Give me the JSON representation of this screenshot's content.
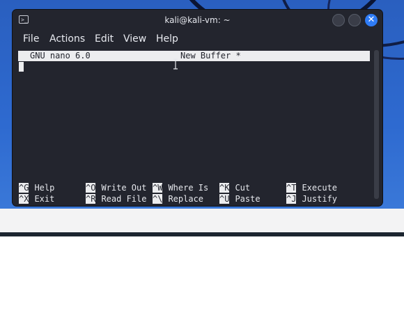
{
  "window": {
    "title": "kali@kali-vm: ~",
    "menu": [
      "File",
      "Actions",
      "Edit",
      "View",
      "Help"
    ]
  },
  "nano": {
    "version": "GNU nano 6.0",
    "buffer": "New Buffer *",
    "shortcuts_row1": [
      {
        "key": "^G",
        "label": "Help"
      },
      {
        "key": "^O",
        "label": "Write Out"
      },
      {
        "key": "^W",
        "label": "Where Is"
      },
      {
        "key": "^K",
        "label": "Cut"
      },
      {
        "key": "^T",
        "label": "Execute"
      }
    ],
    "shortcuts_row2": [
      {
        "key": "^X",
        "label": "Exit"
      },
      {
        "key": "^R",
        "label": "Read File"
      },
      {
        "key": "^\\",
        "label": "Replace"
      },
      {
        "key": "^U",
        "label": "Paste"
      },
      {
        "key": "^J",
        "label": "Justify"
      }
    ]
  },
  "colors": {
    "terminal_bg": "#23252e",
    "nano_bar": "#ecedef",
    "close_button": "#2f7cf6",
    "wallpaper": "#2e6ad0"
  },
  "icons": {
    "terminal": "terminal-icon",
    "minimize": "minimize-icon",
    "maximize": "maximize-icon",
    "close": "close-icon",
    "cursor": "text-cursor-icon"
  }
}
